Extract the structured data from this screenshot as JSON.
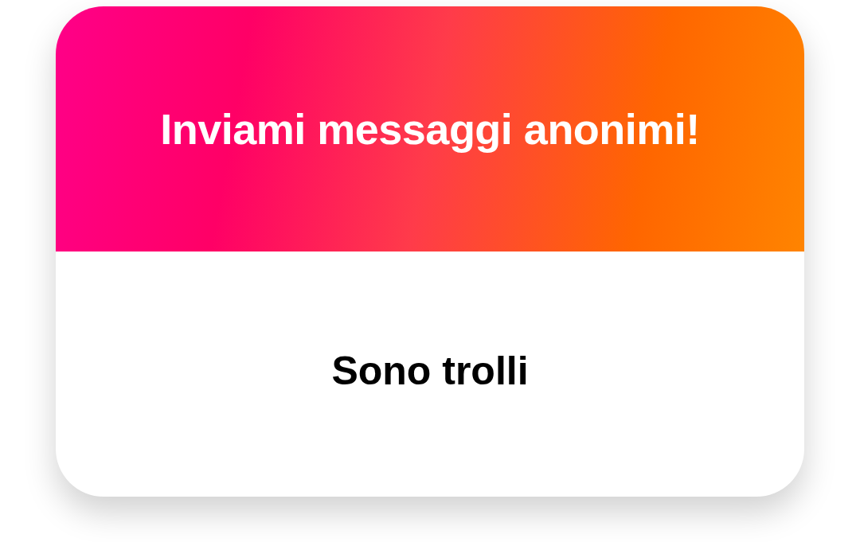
{
  "card": {
    "header": {
      "title": "Inviami messaggi anonimi!"
    },
    "message": "Sono trolli"
  }
}
